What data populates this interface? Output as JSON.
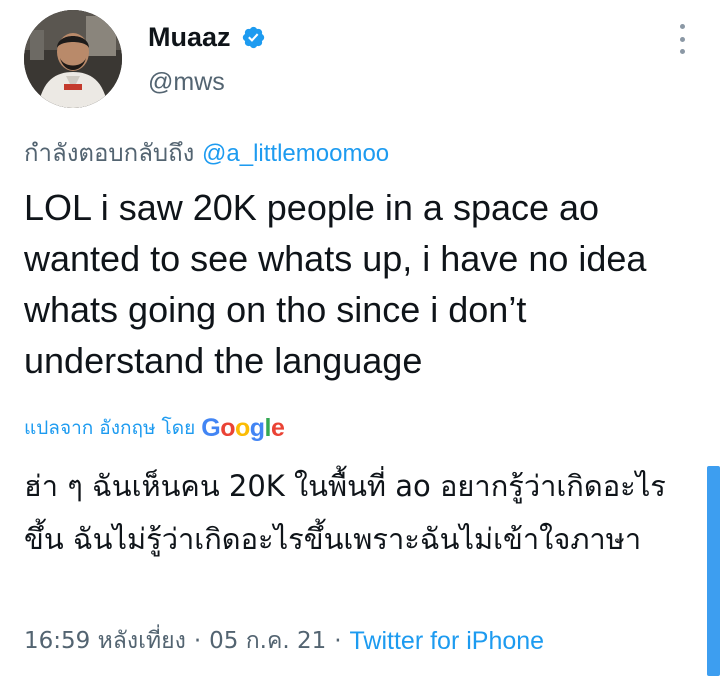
{
  "author": {
    "display_name": "Muaaz",
    "handle": "@mws",
    "verified": true
  },
  "reply": {
    "prefix": "กำลังตอบกลับถึง",
    "mention": "@a_littlemoomoo"
  },
  "tweet": {
    "text": "LOL i saw 20K people in a space ao wanted to see whats up, i have no idea whats going on tho since i don’t understand the language"
  },
  "translation": {
    "label": "แปลจาก อังกฤษ โดย",
    "provider": "Google",
    "text": "ฮ่า ๆ ฉันเห็นคน 20K ในพื้นที่ ao อยากรู้ว่าเกิดอะไรขึ้น ฉันไม่รู้ว่าเกิดอะไรขึ้นเพราะฉันไม่เข้าใจภาษา"
  },
  "meta": {
    "time": "16:59 หลังเที่ยง",
    "date": "05 ก.ค. 21",
    "separator": "·",
    "source": "Twitter for iPhone"
  },
  "colors": {
    "accent": "#1d9bf0",
    "secondary_text": "#536471",
    "primary_text": "#0f1419"
  },
  "icons": {
    "verified": "verified-badge-icon",
    "more": "more-vertical-icon"
  }
}
